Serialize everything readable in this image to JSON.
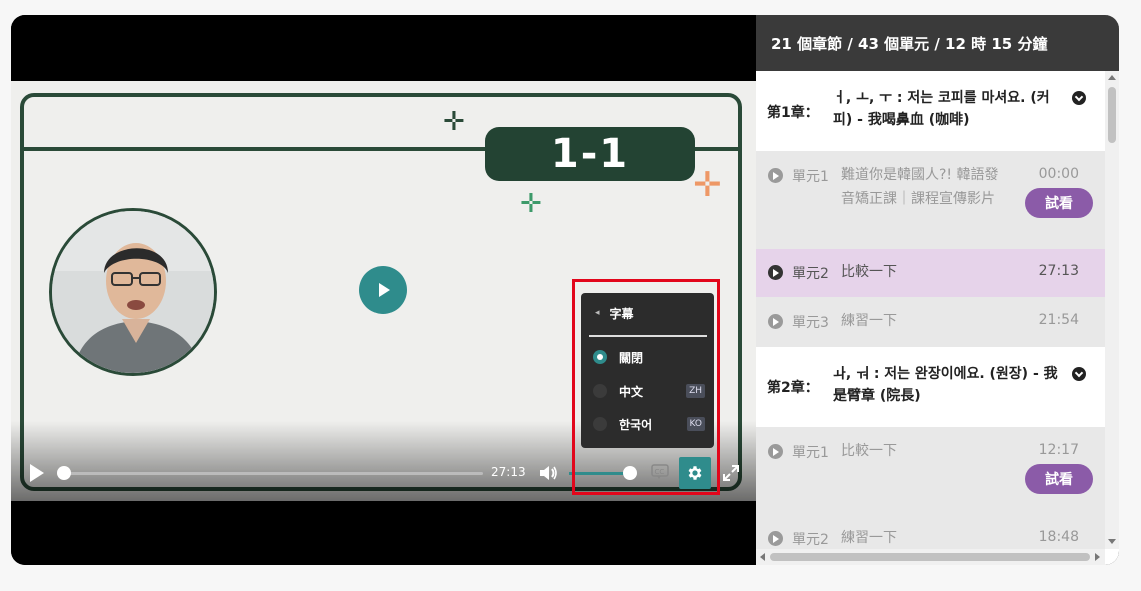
{
  "player": {
    "slide_tag": "1-1",
    "current_time": "27:13",
    "volume_fraction": 0.9,
    "settings_menu": {
      "title": "字幕",
      "options": [
        {
          "label": "關閉",
          "code": "",
          "selected": true
        },
        {
          "label": "中文",
          "code": "ZH",
          "selected": false
        },
        {
          "label": "한국어",
          "code": "KO",
          "selected": false
        }
      ]
    },
    "accent_color": "#2f8c8c"
  },
  "sidebar": {
    "summary": "21 個章節 / 43 個單元 / 12 時 15 分鐘",
    "chapters": [
      {
        "prefix": "第1章：",
        "title": "ㅓ, ㅗ, ㅜ : 저는 코피를 마셔요. (커피) - 我喝鼻血 (咖啡)",
        "units": [
          {
            "num": "單元1",
            "title": "難道你是韓國人?! 韓語發音矯正課｜課程宣傳影片",
            "time": "00:00",
            "preview": "試看"
          },
          {
            "num": "單元2",
            "title": "比較一下",
            "time": "27:13",
            "active": true
          },
          {
            "num": "單元3",
            "title": "練習一下",
            "time": "21:54"
          }
        ]
      },
      {
        "prefix": "第2章：",
        "title": "ㅘ, ㅝ : 저는 완장이에요. (원장) - 我是臂章 (院長)",
        "units": [
          {
            "num": "單元1",
            "title": "比較一下",
            "time": "12:17",
            "preview": "試看"
          },
          {
            "num": "單元2",
            "title": "練習一下",
            "time": "18:48"
          }
        ]
      }
    ],
    "preview_color": "#8b5ba8",
    "active_color": "#e6d3ea"
  }
}
